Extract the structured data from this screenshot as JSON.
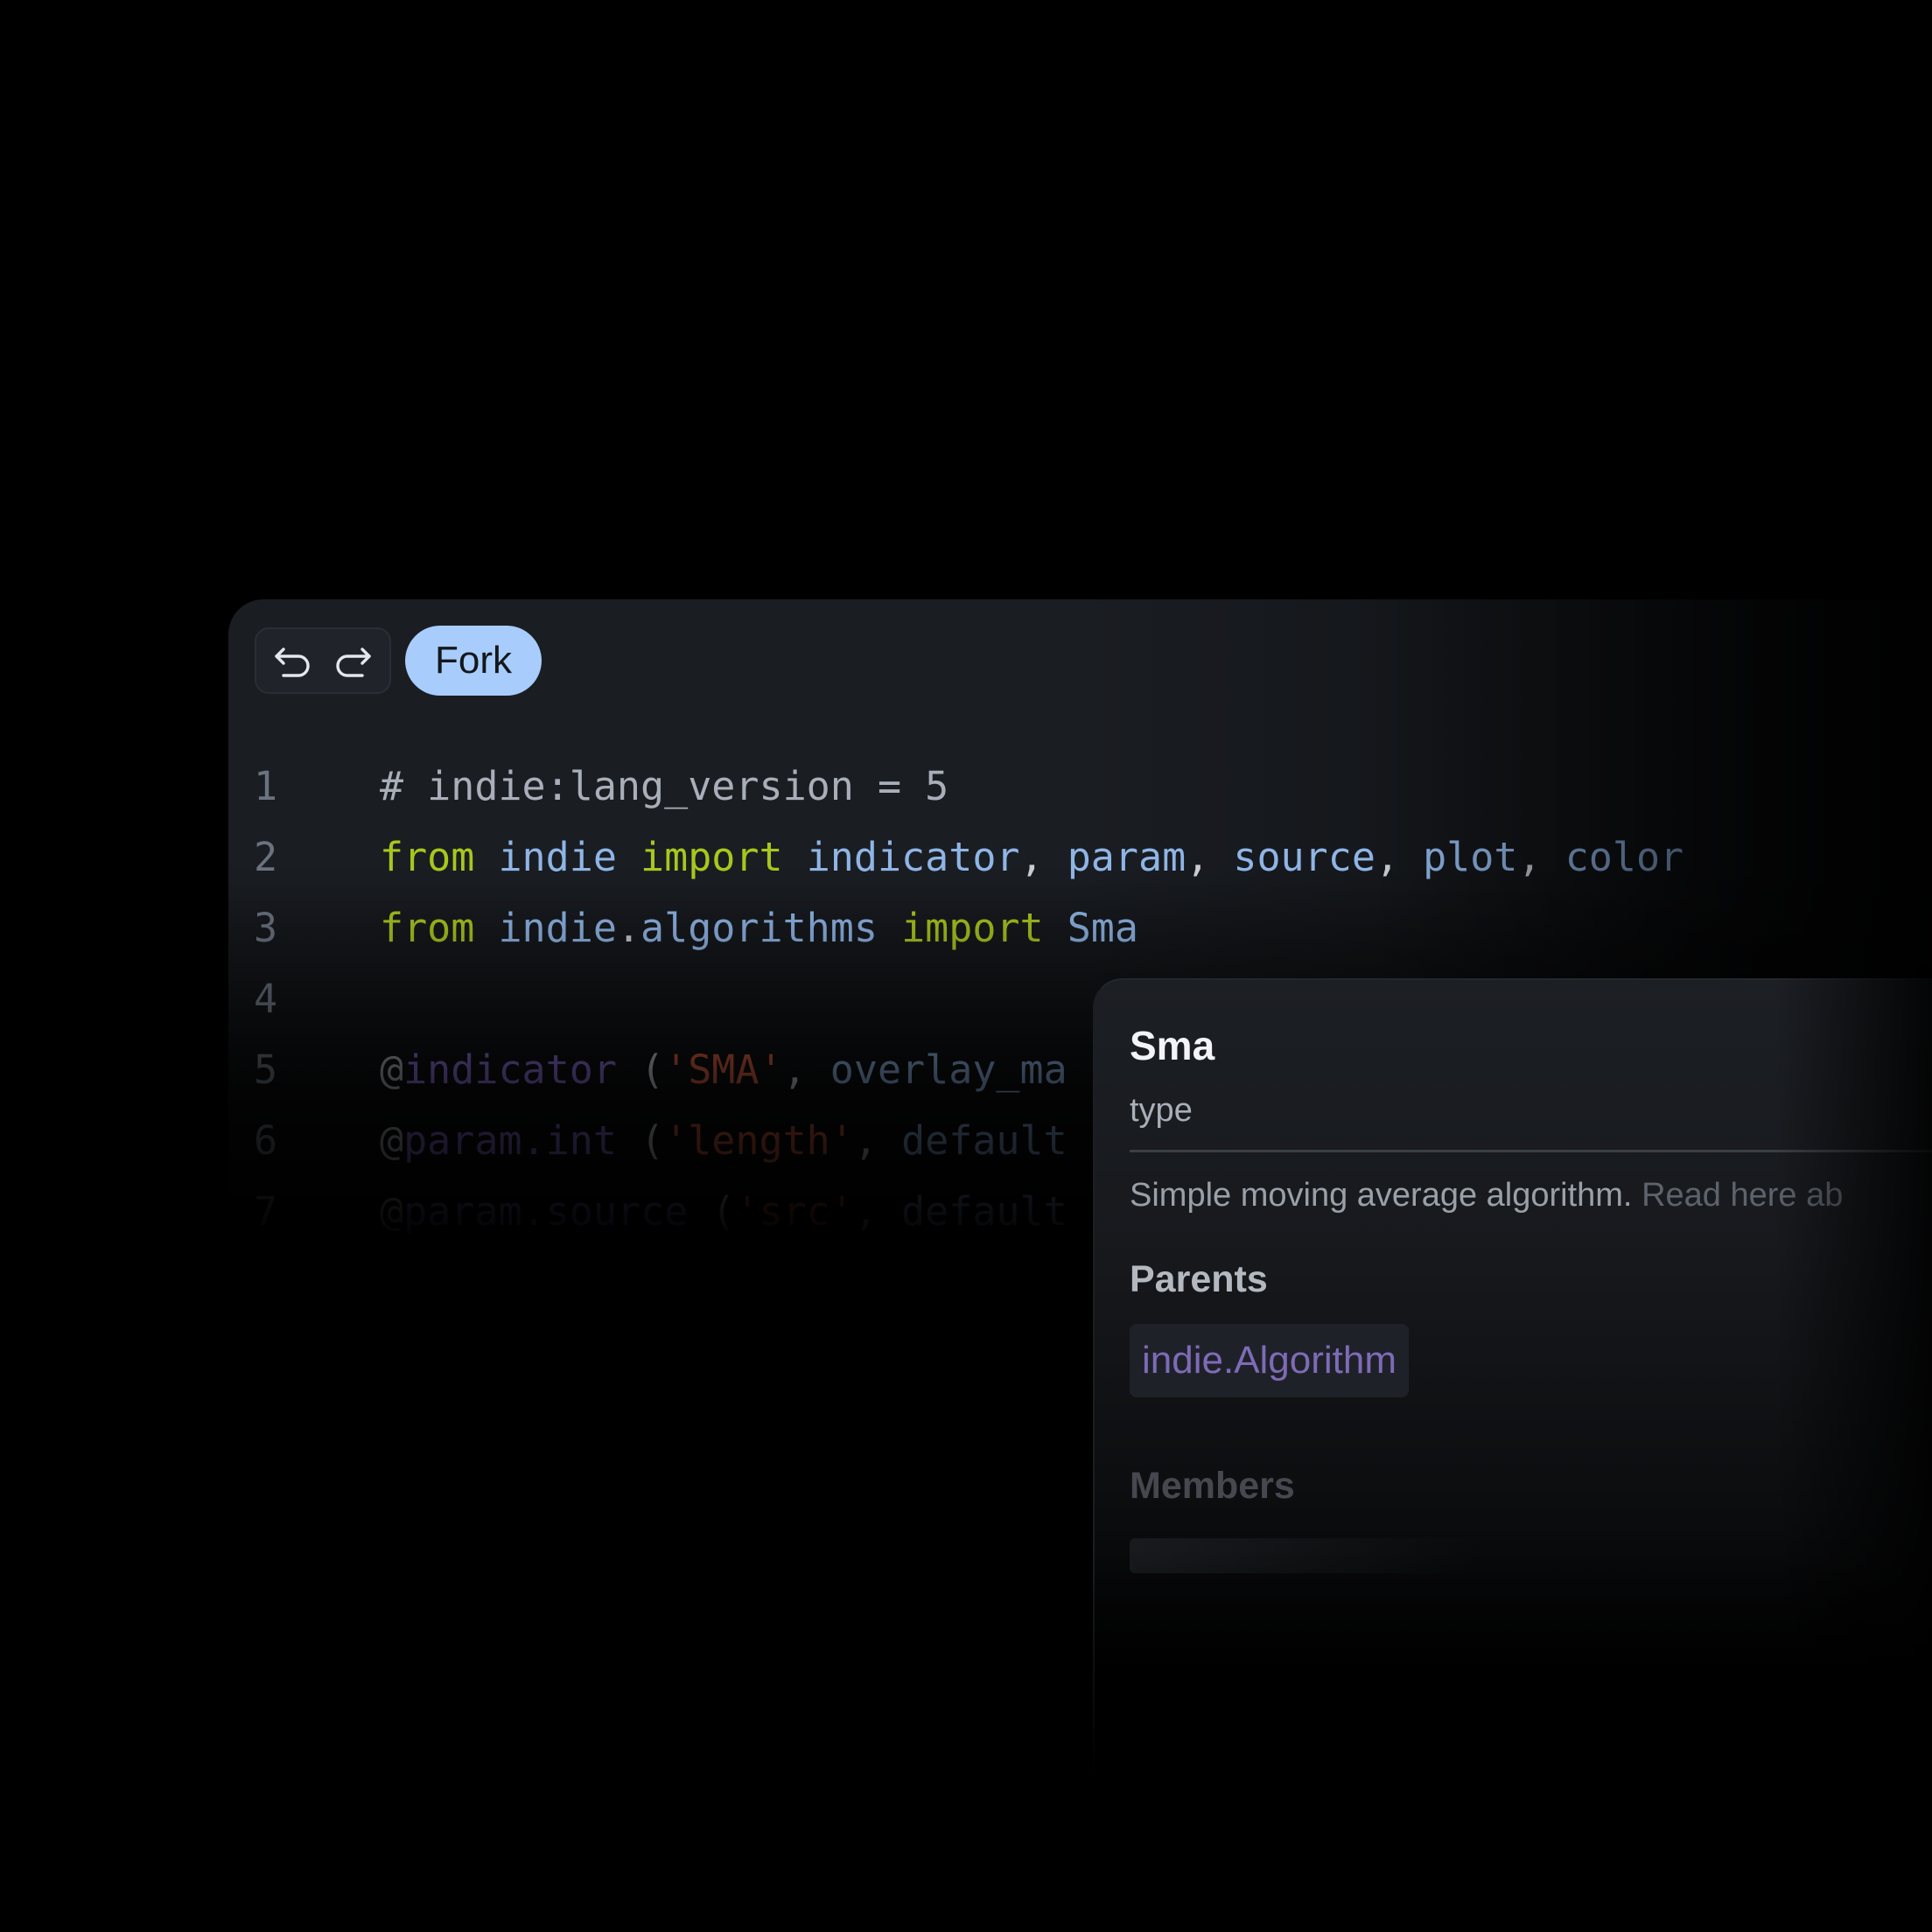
{
  "toolbar": {
    "undo_icon": "undo-icon",
    "redo_icon": "redo-icon",
    "fork_label": "Fork",
    "fork_color": "#a8cdfc"
  },
  "editor": {
    "lines": [
      {
        "number": "1",
        "tokens": [
          {
            "t": "# indie:lang_version = 5",
            "k": "com"
          }
        ]
      },
      {
        "number": "2",
        "tokens": [
          {
            "t": "from",
            "k": "kw"
          },
          {
            "t": " ",
            "k": "pun"
          },
          {
            "t": "indie",
            "k": "id"
          },
          {
            "t": " ",
            "k": "pun"
          },
          {
            "t": "import",
            "k": "kw"
          },
          {
            "t": " ",
            "k": "pun"
          },
          {
            "t": "indicator",
            "k": "id"
          },
          {
            "t": ", ",
            "k": "pun"
          },
          {
            "t": "param",
            "k": "id"
          },
          {
            "t": ", ",
            "k": "pun"
          },
          {
            "t": "source",
            "k": "id"
          },
          {
            "t": ", ",
            "k": "pun"
          },
          {
            "t": "plot",
            "k": "id"
          },
          {
            "t": ", ",
            "k": "pun"
          },
          {
            "t": "color",
            "k": "id"
          }
        ]
      },
      {
        "number": "3",
        "tokens": [
          {
            "t": "from",
            "k": "kw"
          },
          {
            "t": " ",
            "k": "pun"
          },
          {
            "t": "indie",
            "k": "id"
          },
          {
            "t": ".",
            "k": "pun"
          },
          {
            "t": "algorithms",
            "k": "id"
          },
          {
            "t": " ",
            "k": "pun"
          },
          {
            "t": "import",
            "k": "kw"
          },
          {
            "t": " ",
            "k": "pun"
          },
          {
            "t": "Sma",
            "k": "id"
          }
        ]
      },
      {
        "number": "4",
        "tokens": []
      },
      {
        "number": "5",
        "tokens": [
          {
            "t": "@",
            "k": "dec"
          },
          {
            "t": "indicator",
            "k": "fn"
          },
          {
            "t": " (",
            "k": "pun"
          },
          {
            "t": "'SMA'",
            "k": "str"
          },
          {
            "t": ", ",
            "k": "pun"
          },
          {
            "t": "overlay_ma",
            "k": "arg"
          }
        ]
      },
      {
        "number": "6",
        "tokens": [
          {
            "t": "@",
            "k": "dec"
          },
          {
            "t": "param.int",
            "k": "fn"
          },
          {
            "t": " (",
            "k": "pun"
          },
          {
            "t": "'length'",
            "k": "str"
          },
          {
            "t": ", ",
            "k": "pun"
          },
          {
            "t": "default",
            "k": "arg"
          }
        ]
      },
      {
        "number": "7",
        "tokens": [
          {
            "t": "@",
            "k": "dec"
          },
          {
            "t": "param.source",
            "k": "fn"
          },
          {
            "t": " (",
            "k": "pun"
          },
          {
            "t": "'src'",
            "k": "str"
          },
          {
            "t": ", ",
            "k": "pun"
          },
          {
            "t": "default",
            "k": "arg"
          }
        ]
      }
    ]
  },
  "popup": {
    "name": "Sma",
    "kind": "type",
    "description": "Simple moving average algorithm. ",
    "description_link": "Read here ab",
    "parents_heading": "Parents",
    "parent": "indie.Algorithm",
    "members_heading": "Members"
  },
  "colors": {
    "background": "#000000",
    "editor_background": "#1a1d22",
    "keyword": "#a8c71d",
    "identifier": "#8fb5e6",
    "string": "#d8603f",
    "decorator": "#8c6fd6",
    "line_number": "#6b7380"
  }
}
